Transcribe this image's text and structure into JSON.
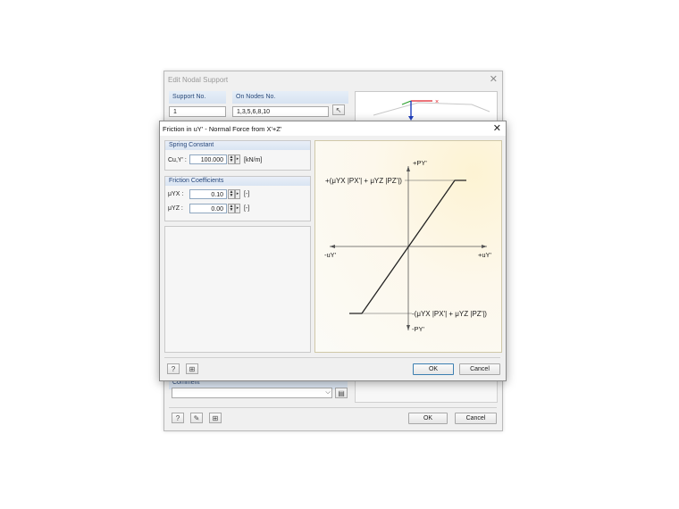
{
  "background_dialog": {
    "title": "Edit Nodal Support",
    "support_no_header": "Support No.",
    "support_no_value": "1",
    "on_nodes_header": "On Nodes No.",
    "on_nodes_value": "1,3,5,6,8,10",
    "comment_header": "Comment",
    "comment_value": "",
    "ok_label": "OK",
    "cancel_label": "Cancel"
  },
  "dialog": {
    "title": "Friction in uY' - Normal Force from X'+Z'",
    "spring": {
      "header": "Spring Constant",
      "label": "Cu,Y' :",
      "value": "100.000",
      "unit": "[kN/m]"
    },
    "friction": {
      "header": "Friction Coefficients",
      "uyx_label": "μYX :",
      "uyx_value": "0.10",
      "uyx_unit": "[-]",
      "uyz_label": "μYZ :",
      "uyz_value": "0.00",
      "uyz_unit": "[-]"
    },
    "diagram": {
      "top_axis": "+PY'",
      "bottom_axis": "-PY'",
      "left_axis": "-uY'",
      "right_axis": "+uY'",
      "upper_formula": "+(μYX |PX'| + μYZ |PZ'|)",
      "lower_formula": "-(μYX |PX'| + μYZ |PZ'|)"
    },
    "ok_label": "OK",
    "cancel_label": "Cancel"
  },
  "icons": [
    "close-icon",
    "help-icon",
    "units-icon",
    "edit-icon",
    "select-nodes-icon",
    "dropdown-icon",
    "library-icon",
    "spin-icon"
  ],
  "colors": {
    "axis_x": "#e0222a",
    "axis_y": "#2aa02a",
    "axis_z": "#1f3fbf",
    "diagram_bg": "#fcf6e2"
  }
}
